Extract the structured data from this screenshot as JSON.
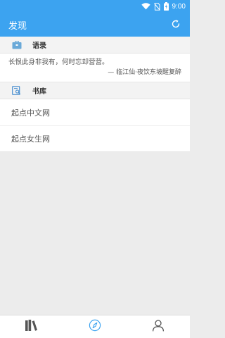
{
  "status_bar": {
    "time": "9:00"
  },
  "app_bar": {
    "title": "发现"
  },
  "sections": {
    "quote": {
      "title": "语录",
      "text": "长恨此身非我有，何时忘却营营。",
      "source": "— 临江仙·夜饮东坡醒复醉"
    },
    "library": {
      "title": "书库",
      "items": [
        {
          "label": "起点中文网"
        },
        {
          "label": "起点女生网"
        }
      ]
    }
  },
  "bottom_nav": {
    "items": [
      {
        "icon": "bookshelf-icon",
        "active": false
      },
      {
        "icon": "compass-icon",
        "active": true
      },
      {
        "icon": "user-icon",
        "active": false
      }
    ]
  },
  "colors": {
    "primary": "#3ca3f0",
    "background": "#ececec",
    "inactive_icon": "#555555"
  }
}
